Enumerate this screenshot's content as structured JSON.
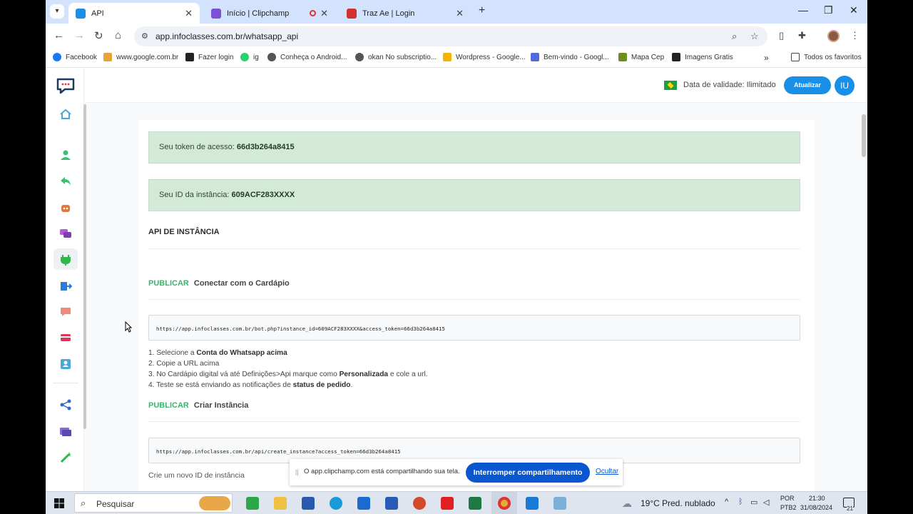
{
  "browser": {
    "tabs": [
      {
        "label": "API",
        "color": "#1a8fe8",
        "active": true
      },
      {
        "label": "Início | Clipchamp",
        "color": "#7b4fd6",
        "active": false
      },
      {
        "label": "Traz Ae | Login",
        "color": "#d33030",
        "active": false
      }
    ],
    "new_tab": "+",
    "window_controls": {
      "minimize": "—",
      "maximize": "❐",
      "close": "✕"
    },
    "url": "app.infoclasses.com.br/whatsapp_api",
    "bookmarks": [
      {
        "label": "Facebook",
        "color": "#1877f2"
      },
      {
        "label": "www.google.com.br",
        "color": "#e8a33a"
      },
      {
        "label": "Fazer login",
        "color": "#222222"
      },
      {
        "label": "ig",
        "color": "#25d366"
      },
      {
        "label": "Conheça o Android...",
        "color": "#555555"
      },
      {
        "label": "okan No subscriptio...",
        "color": "#555555"
      },
      {
        "label": "Wordpress - Google...",
        "color": "#f4b400"
      },
      {
        "label": "Bem-vindo - Googl...",
        "color": "#4f6bdb"
      },
      {
        "label": "Mapa Cep",
        "color": "#6b8e23"
      },
      {
        "label": "Imagens Gratis",
        "color": "#222222"
      }
    ],
    "more_bookmarks": "»",
    "all_favorites": "Todos os favoritos"
  },
  "app": {
    "validity": "Data de validade: Ilimitado",
    "update_button": "Atualizar",
    "avatar_initials": "IU",
    "token_label": "Seu token de acesso:",
    "token_value": "66d3b264a8415",
    "instance_label": "Seu ID da instância:",
    "instance_value": "609ACF283XXXX",
    "section_title": "API DE INSTÂNCIA",
    "endpoints": [
      {
        "method": "PUBLICAR",
        "title": "Conectar com o Cardápio",
        "url": "https://app.infoclasses.com.br/bot.php?instance_id=609ACF283XXXX&access_token=66d3b264a8415"
      },
      {
        "method": "PUBLICAR",
        "title": "Criar Instância",
        "url": "https://app.infoclasses.com.br/api/create_instance?access_token=66d3b264a8415"
      }
    ],
    "instructions": {
      "s1a": "1. Selecione a ",
      "s1b": "Conta do Whatsapp acima",
      "s2": "2. Copie a URL acima",
      "s3a": "3. No Cardápio digital vá até Definições>Api marque como ",
      "s3b": "Personalizada",
      "s3c": " e cole a url.",
      "s4a": "4. Teste se está enviando as notificações de ",
      "s4b": "status de pedido",
      "s4c": "."
    },
    "create_note": "Crie um novo ID de instância"
  },
  "sharebar": {
    "message": "O app.clipchamp.com está compartilhando sua tela.",
    "stop": "Interromper compartilhamento",
    "hide": "Ocultar"
  },
  "taskbar": {
    "search_placeholder": "Pesquisar",
    "weather_temp": "19°C",
    "weather_desc": "Pred. nublado",
    "lang": "POR",
    "layout": "PTB2",
    "time": "21:30",
    "date": "31/08/2024",
    "notifications": "21"
  }
}
